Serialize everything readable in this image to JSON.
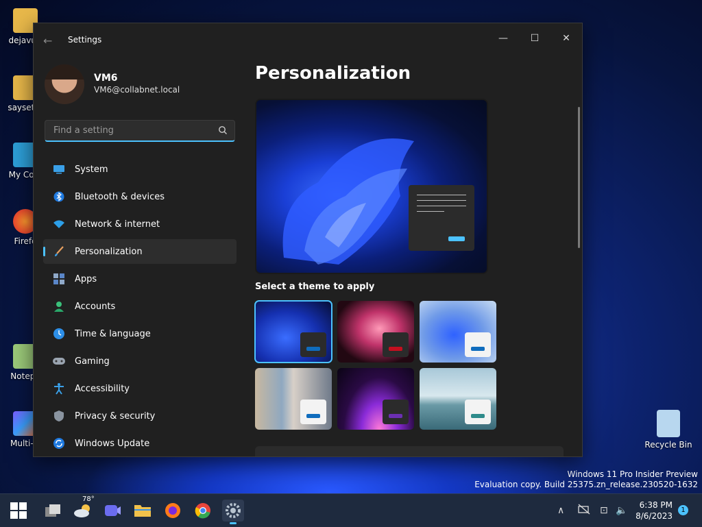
{
  "desktop": {
    "icons": [
      {
        "label": "dejavu-f",
        "icon": "folder-icon"
      },
      {
        "label": "saysetth",
        "icon": "folder-icon"
      },
      {
        "label": "My Com",
        "icon": "computer-icon"
      },
      {
        "label": "Firefo",
        "icon": "firefox-icon"
      },
      {
        "label": "Notepa",
        "icon": "notepad-icon"
      },
      {
        "label": "Multi-M",
        "icon": "multi-monitor-icon"
      }
    ],
    "recycle_bin": "Recycle Bin",
    "watermark": {
      "line1": "Windows 11 Pro Insider Preview",
      "line2": "Evaluation copy. Build 25375.zn_release.230520-1632"
    }
  },
  "window": {
    "title": "Settings",
    "back": "←",
    "minimize": "—",
    "maximize": "☐",
    "close": "✕"
  },
  "profile": {
    "name": "VM6",
    "email": "VM6@collabnet.local"
  },
  "search": {
    "placeholder": "Find a setting"
  },
  "nav": [
    {
      "label": "System",
      "icon": "system-icon"
    },
    {
      "label": "Bluetooth & devices",
      "icon": "bluetooth-icon"
    },
    {
      "label": "Network & internet",
      "icon": "wifi-icon"
    },
    {
      "label": "Personalization",
      "icon": "brush-icon",
      "active": true
    },
    {
      "label": "Apps",
      "icon": "apps-icon"
    },
    {
      "label": "Accounts",
      "icon": "accounts-icon"
    },
    {
      "label": "Time & language",
      "icon": "time-language-icon"
    },
    {
      "label": "Gaming",
      "icon": "gaming-icon"
    },
    {
      "label": "Accessibility",
      "icon": "accessibility-icon"
    },
    {
      "label": "Privacy & security",
      "icon": "shield-icon"
    },
    {
      "label": "Windows Update",
      "icon": "windows-update-icon"
    }
  ],
  "content": {
    "title": "Personalization",
    "theme_heading": "Select a theme to apply",
    "themes": [
      {
        "id": "windows-dark",
        "selected": true,
        "accent": "#0f6cbd"
      },
      {
        "id": "glow",
        "selected": false,
        "accent": "#c50f1f"
      },
      {
        "id": "windows-light",
        "selected": false,
        "accent": "#0f6cbd"
      },
      {
        "id": "flowers",
        "selected": false,
        "accent": "#0f6cbd"
      },
      {
        "id": "captured-motion",
        "selected": false,
        "accent": "#6b2fb3"
      },
      {
        "id": "sunrise",
        "selected": false,
        "accent": "#2e8b8b"
      }
    ]
  },
  "taskbar": {
    "weather_temp": "78°",
    "time": "6:38 PM",
    "date": "8/6/2023",
    "notifications": "1",
    "tray": {
      "chevron": "∧",
      "network": "⊡",
      "volume": "🔈"
    }
  },
  "colors": {
    "accent": "#4cc2ff",
    "window_bg": "#202020",
    "taskbar_bg": "#1e2a3e"
  }
}
